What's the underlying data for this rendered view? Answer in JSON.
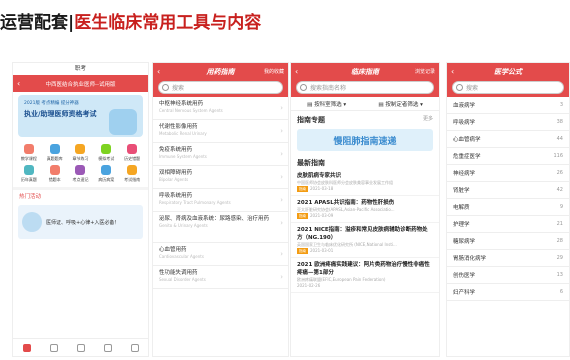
{
  "title_prefix": "运营配套",
  "title_main": "医生临床常用工具与内容",
  "phone1": {
    "status_title": "职考",
    "header": "中西医结合执业医师--试用版",
    "banner_title": "执业/助理医师资格考试",
    "banner_sub": "2021版 考点精编 提分神器",
    "icons": [
      "教学课程",
      "真题题库",
      "章节练习",
      "模拟考试",
      "历史错题",
      "历年真题",
      "错题本",
      "考点速记",
      "病历病案",
      "考试指南"
    ],
    "notice_title": "热门活动",
    "notice_text": "医师证、呼吸+心律+入医必备！"
  },
  "phone2": {
    "header": "用药指南",
    "right": "我的收藏",
    "search_placeholder": "搜索",
    "items": [
      {
        "t": "中枢神经系统用药",
        "s": "Central Nervous System Agents"
      },
      {
        "t": "代谢性影像用药",
        "s": "Metabolic Renal Urinary"
      },
      {
        "t": "免疫系统用药",
        "s": "Immune System Agents"
      },
      {
        "t": "双相障碍用药",
        "s": "Bipolar Agents"
      },
      {
        "t": "呼吸系统用药",
        "s": "Respiratory Tract Pulmonary Agents"
      },
      {
        "t": "泌尿、肾病及血液系统：尿路感染、治疗用药",
        "s": "Genito & Urinary Agents"
      },
      {
        "t": "心血管用药",
        "s": "Cardiovascular Agents"
      },
      {
        "t": "性功能失调用药",
        "s": "Sexual Disorder Agents"
      }
    ]
  },
  "phone3": {
    "header": "临床指南",
    "right": "浏览记录",
    "search_placeholder": "搜索指南名称",
    "filter1": "按科室筛选",
    "filter2": "按制定者筛选",
    "topic_label": "指南专题",
    "more": "更多",
    "topic_banner": "慢阻肺指南速递",
    "latest_label": "最新指南",
    "news": [
      {
        "t": "皮肤肌病专家共识",
        "s": "中国医师协会皮肤科医师分会皮肤美容事业发展工作组",
        "d": "2021-03-18"
      },
      {
        "t": "2021 APASL共识指南：药物性肝损伤",
        "s": "亚太肝脏研究协会(APASL,Asian-Pacific Associatio...",
        "d": "2021-03-09"
      },
      {
        "t": "2021 NICE指南：溢疹和常见皮肤病辅助诊断药物处方（NG.190）",
        "s": "英国国家卫生与临床优化研究所 (NICE,National Insti...",
        "d": "2021-03-01"
      },
      {
        "t": "2021 欧洲疼痛实践建议：阿片类药物治疗慢性非癌性疼痛—第1部分",
        "s": "欧洲疼痛联盟(EFIC,European Pain Federation)",
        "d": "2021-02-26"
      }
    ]
  },
  "phone4": {
    "header": "医学公式",
    "search_placeholder": "搜索",
    "items": [
      {
        "t": "血液病学",
        "n": "3"
      },
      {
        "t": "呼吸病学",
        "n": "38"
      },
      {
        "t": "心血管病学",
        "n": "44"
      },
      {
        "t": "危重症医学",
        "n": "116"
      },
      {
        "t": "神经病学",
        "n": "26"
      },
      {
        "t": "肾脏学",
        "n": "42"
      },
      {
        "t": "电解质",
        "n": "9"
      },
      {
        "t": "护理学",
        "n": "21"
      },
      {
        "t": "糖尿病学",
        "n": "28"
      },
      {
        "t": "胃肠消化病学",
        "n": "29"
      },
      {
        "t": "创伤医学",
        "n": "13"
      },
      {
        "t": "妇产科学",
        "n": "6"
      }
    ]
  }
}
